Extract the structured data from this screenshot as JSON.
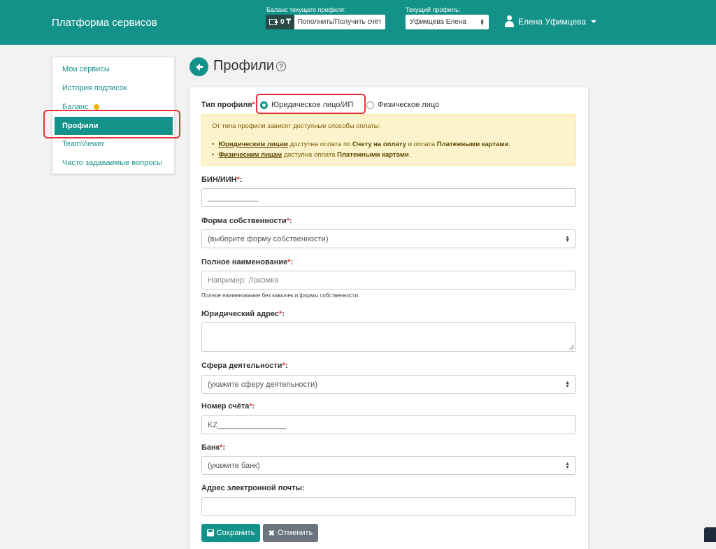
{
  "header": {
    "brand": "Платформа сервисов",
    "balance_label": "Баланс текущего профиля:",
    "balance_value": "0 ₸",
    "topup_label": "Пополнить/Получить счёт",
    "profile_label": "Текущий профиль:",
    "profile_value": "Уфимцева Елена",
    "user_name": "Елена Уфимцева"
  },
  "sidebar": {
    "items": [
      {
        "label": "Мои сервисы"
      },
      {
        "label": "История подписок"
      },
      {
        "label": "Баланс"
      },
      {
        "label": "Профили",
        "active": true
      },
      {
        "label": "TeamViewer"
      },
      {
        "label": "Часто задаваемые вопросы"
      }
    ]
  },
  "page": {
    "title": "Профили",
    "help": "?"
  },
  "form": {
    "profile_type_label": "Тип профиля",
    "profile_type_options": [
      "Юридическое лицо/ИП",
      "Физическое лицо"
    ],
    "profile_type_selected": "Юридическое лицо/ИП",
    "notice": {
      "intro": "От типа профиля зависят доступные способы оплаты:",
      "item1": {
        "who": "Юридическим лицам",
        "mid": " доступна оплата по ",
        "m1": "Счету на оплату",
        "and": " и оплата ",
        "m2": "Платежными картами",
        "end": "."
      },
      "item2": {
        "who": "Физическим лицам",
        "mid": " доступна оплата ",
        "m1": "Платежными картами",
        "end": "."
      }
    },
    "bin_label": "БИН/ИИН",
    "bin_value": "____________",
    "ownership_label": "Форма собственности",
    "ownership_value": "(выберите форму собственности)",
    "fullname_label": "Полное наименование",
    "fullname_placeholder": "Например: Лакомка",
    "fullname_hint": "Полное наименование без кавычек и формы собственности.",
    "address_label": "Юридический адрес",
    "address_value": "",
    "activity_label": "Сфера деятельности",
    "activity_value": "(укажите сферу деятельности)",
    "account_label": "Номер счёта",
    "account_value": "KZ________________",
    "bank_label": "Банк",
    "bank_value": "(укажите банк)",
    "email_label": "Адрес электронной почты:",
    "email_value": "",
    "required_mark": "*",
    "colon": ":",
    "save_label": "Сохранить",
    "cancel_label": "Отменить"
  },
  "colors": {
    "accent": "#13928a",
    "highlight": "#e8323c",
    "notice_bg": "#fcf3cc",
    "balance_dot": "#f0b400"
  },
  "icons": [
    "wallet-icon",
    "user-icon",
    "caret-down-icon",
    "back-arrow-icon",
    "help-icon",
    "save-icon",
    "close-icon",
    "select-arrows-icon"
  ]
}
